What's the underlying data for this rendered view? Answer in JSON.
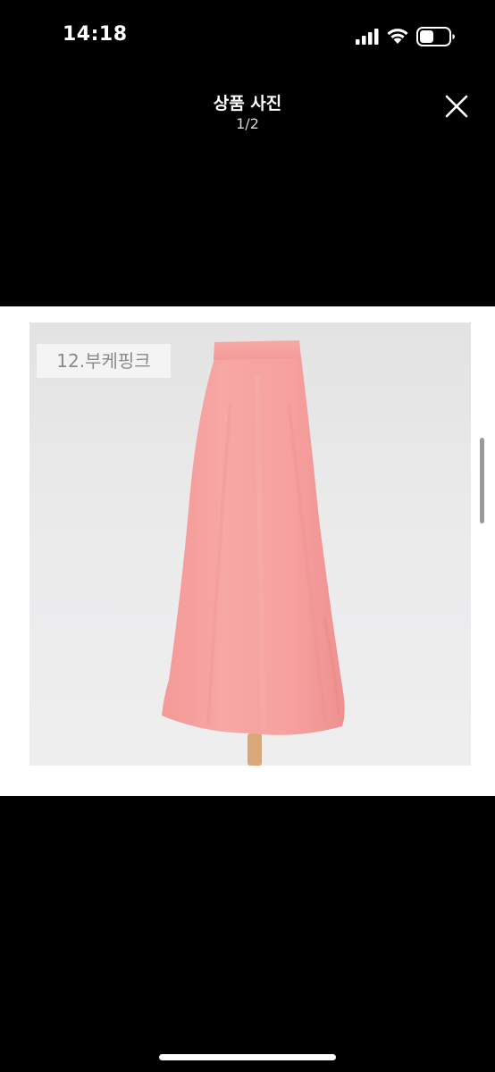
{
  "status_bar": {
    "time": "14:18",
    "signal_icon": "cellular-signal-icon",
    "wifi_icon": "wifi-icon",
    "battery_icon": "battery-icon"
  },
  "header": {
    "title": "상품 사진",
    "counter": "1/2",
    "close_icon": "close-icon"
  },
  "photo": {
    "label": "12.부케핑크",
    "accent_color": "#f6a0a0"
  },
  "colors": {
    "background": "#000000",
    "frame": "#ffffff",
    "skirt": "#f6a0a0"
  }
}
